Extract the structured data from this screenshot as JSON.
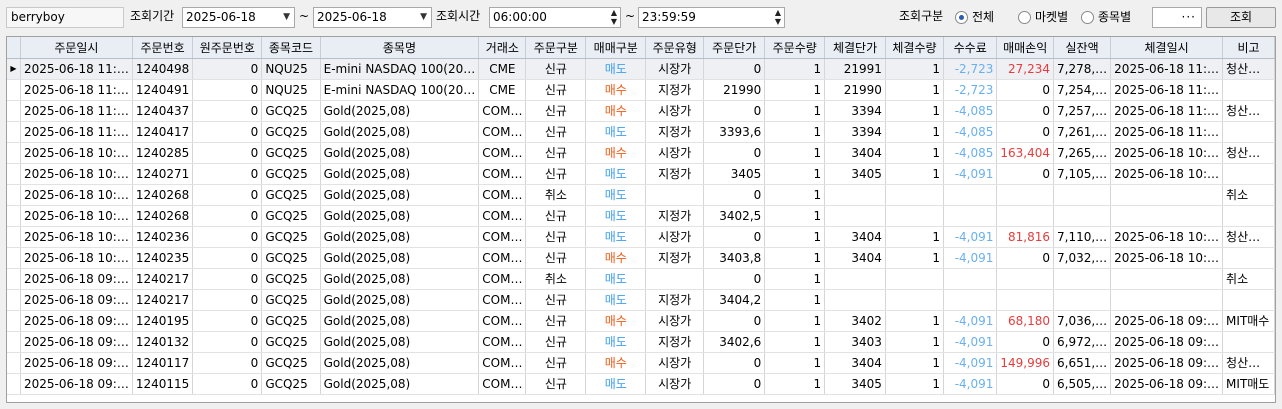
{
  "toolbar": {
    "user": "berryboy",
    "period_label": "조회기간",
    "date_from": "2025-06-18",
    "tilde": "~",
    "date_to": "2025-06-18",
    "time_label": "조회시간",
    "time_from": "06:00:00",
    "time_to": "23:59:59",
    "category_label": "조회구분",
    "radio_all": "전체",
    "radio_market": "마켓별",
    "radio_item": "종목별",
    "selected_radio": "전체",
    "more": "···",
    "search_button": "조회"
  },
  "colors": {
    "sell": "#3c9ef0",
    "buy": "#f05a14",
    "fee": "#6ab0f0",
    "profit": "#e63c3c"
  },
  "columns": [
    "주문일시",
    "주문번호",
    "원주문번호",
    "종목코드",
    "종목명",
    "거래소",
    "주문구분",
    "매매구분",
    "주문유형",
    "주문단가",
    "주문수량",
    "체결단가",
    "체결수량",
    "수수료",
    "매매손익",
    "실잔액",
    "체결일시",
    "비고"
  ],
  "rows": [
    [
      "2025-06-18 11:…",
      "1240498",
      "0",
      "NQU25",
      "E-mini NASDAQ 100(20…",
      "CME",
      "신규",
      "매도",
      "시장가",
      "0",
      "1",
      "21991",
      "1",
      "-2,723",
      "27,234",
      "7,278,…",
      "2025-06-18 11:…",
      "청산…"
    ],
    [
      "2025-06-18 11:…",
      "1240491",
      "0",
      "NQU25",
      "E-mini NASDAQ 100(20…",
      "CME",
      "신규",
      "매수",
      "지정가",
      "21990",
      "1",
      "21990",
      "1",
      "-2,723",
      "0",
      "7,254,…",
      "2025-06-18 11:…",
      ""
    ],
    [
      "2025-06-18 11:…",
      "1240437",
      "0",
      "GCQ25",
      "Gold(2025,08)",
      "COM…",
      "신규",
      "매수",
      "시장가",
      "0",
      "1",
      "3394",
      "1",
      "-4,085",
      "0",
      "7,257,…",
      "2025-06-18 11:…",
      "청산…"
    ],
    [
      "2025-06-18 11:…",
      "1240417",
      "0",
      "GCQ25",
      "Gold(2025,08)",
      "COM…",
      "신규",
      "매도",
      "지정가",
      "3393,6",
      "1",
      "3394",
      "1",
      "-4,085",
      "0",
      "7,261,…",
      "2025-06-18 11:…",
      ""
    ],
    [
      "2025-06-18 10:…",
      "1240285",
      "0",
      "GCQ25",
      "Gold(2025,08)",
      "COM…",
      "신규",
      "매수",
      "시장가",
      "0",
      "1",
      "3404",
      "1",
      "-4,085",
      "163,404",
      "7,265,…",
      "2025-06-18 10:…",
      "청산…"
    ],
    [
      "2025-06-18 10:…",
      "1240271",
      "0",
      "GCQ25",
      "Gold(2025,08)",
      "COM…",
      "신규",
      "매도",
      "지정가",
      "3405",
      "1",
      "3405",
      "1",
      "-4,091",
      "0",
      "7,105,…",
      "2025-06-18 10:…",
      ""
    ],
    [
      "2025-06-18 10:…",
      "1240268",
      "0",
      "GCQ25",
      "Gold(2025,08)",
      "COM…",
      "취소",
      "매도",
      "",
      "0",
      "1",
      "",
      "",
      "",
      "",
      "",
      "",
      "취소"
    ],
    [
      "2025-06-18 10:…",
      "1240268",
      "0",
      "GCQ25",
      "Gold(2025,08)",
      "COM…",
      "신규",
      "매도",
      "지정가",
      "3402,5",
      "1",
      "",
      "",
      "",
      "",
      "",
      "",
      ""
    ],
    [
      "2025-06-18 10:…",
      "1240236",
      "0",
      "GCQ25",
      "Gold(2025,08)",
      "COM…",
      "신규",
      "매도",
      "시장가",
      "0",
      "1",
      "3404",
      "1",
      "-4,091",
      "81,816",
      "7,110,…",
      "2025-06-18 10:…",
      "청산…"
    ],
    [
      "2025-06-18 10:…",
      "1240235",
      "0",
      "GCQ25",
      "Gold(2025,08)",
      "COM…",
      "신규",
      "매수",
      "지정가",
      "3403,8",
      "1",
      "3404",
      "1",
      "-4,091",
      "0",
      "7,032,…",
      "2025-06-18 10:…",
      ""
    ],
    [
      "2025-06-18 09:…",
      "1240217",
      "0",
      "GCQ25",
      "Gold(2025,08)",
      "COM…",
      "취소",
      "매도",
      "",
      "0",
      "1",
      "",
      "",
      "",
      "",
      "",
      "",
      "취소"
    ],
    [
      "2025-06-18 09:…",
      "1240217",
      "0",
      "GCQ25",
      "Gold(2025,08)",
      "COM…",
      "신규",
      "매도",
      "지정가",
      "3404,2",
      "1",
      "",
      "",
      "",
      "",
      "",
      "",
      ""
    ],
    [
      "2025-06-18 09:…",
      "1240195",
      "0",
      "GCQ25",
      "Gold(2025,08)",
      "COM…",
      "신규",
      "매수",
      "시장가",
      "0",
      "1",
      "3402",
      "1",
      "-4,091",
      "68,180",
      "7,036,…",
      "2025-06-18 09:…",
      "MIT매수"
    ],
    [
      "2025-06-18 09:…",
      "1240132",
      "0",
      "GCQ25",
      "Gold(2025,08)",
      "COM…",
      "신규",
      "매도",
      "지정가",
      "3402,6",
      "1",
      "3403",
      "1",
      "-4,091",
      "0",
      "6,972,…",
      "2025-06-18 09:…",
      ""
    ],
    [
      "2025-06-18 09:…",
      "1240117",
      "0",
      "GCQ25",
      "Gold(2025,08)",
      "COM…",
      "신규",
      "매수",
      "시장가",
      "0",
      "1",
      "3404",
      "1",
      "-4,091",
      "149,996",
      "6,651,…",
      "2025-06-18 09:…",
      "청산…"
    ],
    [
      "2025-06-18 09:…",
      "1240115",
      "0",
      "GCQ25",
      "Gold(2025,08)",
      "COM…",
      "신규",
      "매도",
      "시장가",
      "0",
      "1",
      "3405",
      "1",
      "-4,091",
      "0",
      "6,505,…",
      "2025-06-18 09:…",
      "MIT매도"
    ]
  ],
  "current_row_marker": "▶"
}
